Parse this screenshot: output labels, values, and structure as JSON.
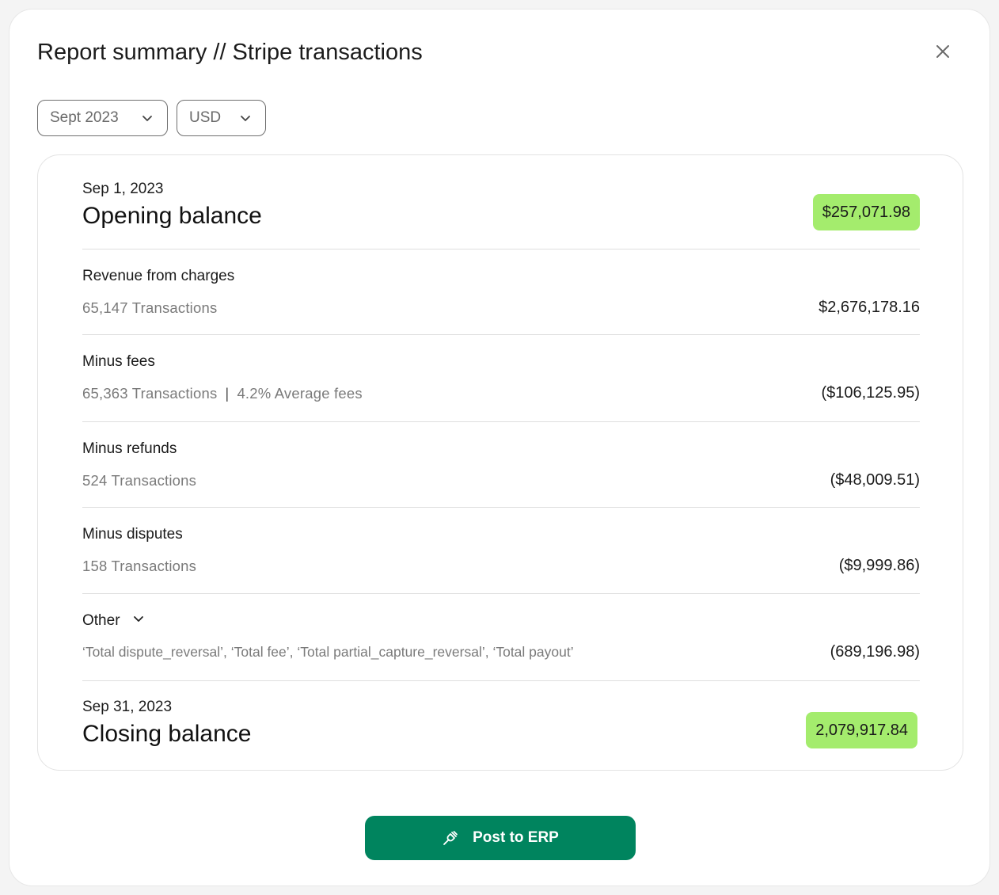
{
  "dialog": {
    "title": "Report summary // Stripe transactions"
  },
  "icons": {
    "close": "close-icon",
    "chevron": "chevron-down-icon",
    "plug": "plug-icon"
  },
  "filters": {
    "period": "Sept 2023",
    "currency": "USD"
  },
  "opening": {
    "date": "Sep 1, 2023",
    "label": "Opening balance",
    "amount": "$257,071.98"
  },
  "rows": [
    {
      "label": "Revenue from charges",
      "transactions": "65,147 Transactions",
      "amount": "$2,676,178.16"
    },
    {
      "label": "Minus fees",
      "transactions": "65,363 Transactions",
      "separator": "|",
      "extra": "4.2% Average fees",
      "amount": "($106,125.95)"
    },
    {
      "label": "Minus refunds",
      "transactions": "524 Transactions",
      "amount": "($48,009.51)"
    },
    {
      "label": "Minus disputes",
      "transactions": "158 Transactions",
      "amount": "($9,999.86)"
    }
  ],
  "other": {
    "label": "Other",
    "details": "‘Total dispute_reversal’, ‘Total fee’, ‘Total partial_capture_reversal’, ‘Total payout’",
    "amount": "(689,196.98)"
  },
  "closing": {
    "date": "Sep 31, 2023",
    "label": "Closing balance",
    "amount": "2,079,917.84"
  },
  "actions": {
    "post_label": "Post to ERP"
  },
  "colors": {
    "accent_green": "#a4ec6d",
    "button_green": "#00845e"
  }
}
